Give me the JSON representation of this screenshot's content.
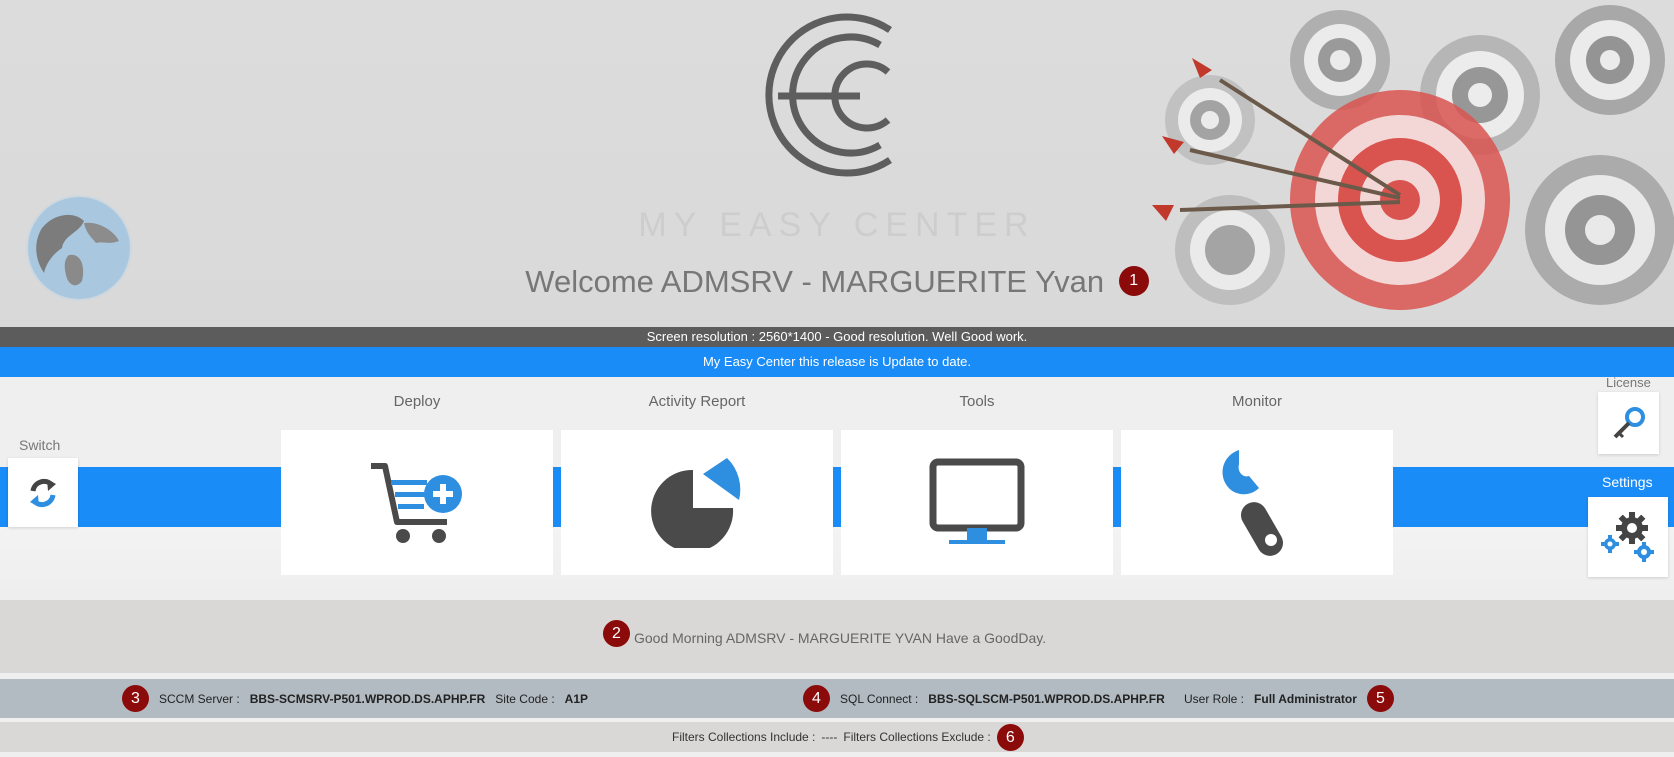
{
  "hero": {
    "brand": "MY EASY CENTER",
    "welcome": "Welcome ADMSRV - MARGUERITE Yvan",
    "badge": "1"
  },
  "status": {
    "resolution": "Screen resolution : 2560*1400 - Good resolution. Well Good work.",
    "update": "My Easy Center this release is Update to date."
  },
  "sidebar_left": {
    "switch_label": "Switch"
  },
  "sidebar_right": {
    "license_label": "License",
    "settings_label": "Settings"
  },
  "tiles": [
    {
      "label": "Deploy",
      "icon": "cart-add-icon"
    },
    {
      "label": "Activity Report",
      "icon": "pie-chart-icon"
    },
    {
      "label": "Tools",
      "icon": "monitor-icon"
    },
    {
      "label": "Monitor",
      "icon": "wrench-icon"
    }
  ],
  "greeting": {
    "badge": "2",
    "text": "Good Morning ADMSRV - MARGUERITE YVAN Have a GoodDay."
  },
  "info": {
    "badge_sccm": "3",
    "sccm_label": "SCCM Server :",
    "sccm_value": "BBS-SCMSRV-P501.WPROD.DS.APHP.FR",
    "site_label": "Site Code :",
    "site_value": "A1P",
    "badge_sql": "4",
    "sql_label": "SQL Connect :",
    "sql_value": "BBS-SQLSCM-P501.WPROD.DS.APHP.FR",
    "role_label": "User Role :",
    "role_value": "Full Administrator",
    "badge_role": "5"
  },
  "filters": {
    "include_label": "Filters Collections Include :",
    "include_value": "----",
    "exclude_label": "Filters Collections Exclude :",
    "badge": "6"
  },
  "colors": {
    "accent": "#1a8cf7",
    "badge": "#8b0a0a",
    "dark_bar": "#5c5c5c",
    "info_bar": "#b3bbc2"
  }
}
